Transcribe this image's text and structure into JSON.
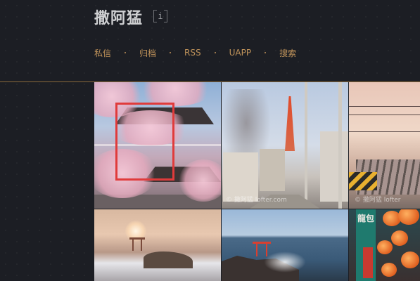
{
  "site": {
    "title": "撒阿猛",
    "info_label": "i"
  },
  "nav": {
    "items": [
      {
        "label": "私信"
      },
      {
        "label": "归档"
      },
      {
        "label": "RSS"
      },
      {
        "label": "UAPP"
      },
      {
        "label": "搜索"
      }
    ]
  },
  "gallery": {
    "photos": [
      {
        "subject": "cherry-blossom-temple",
        "highlighted": true
      },
      {
        "subject": "street-tokyo-tower",
        "watermark": "© 撒阿猛 lofter.com"
      },
      {
        "subject": "railroad-crossing",
        "watermark": "© 撒阿猛 lofter"
      },
      {
        "subject": "torii-waves-sunset"
      },
      {
        "subject": "sea-torii-rocks"
      },
      {
        "subject": "lantern-street-sign",
        "sign_text": "龍包"
      }
    ]
  },
  "colors": {
    "background": "#1c1e24",
    "accent": "#c0935a",
    "header_rule": "#8a6a3c",
    "highlight_box": "#e03b3b"
  }
}
